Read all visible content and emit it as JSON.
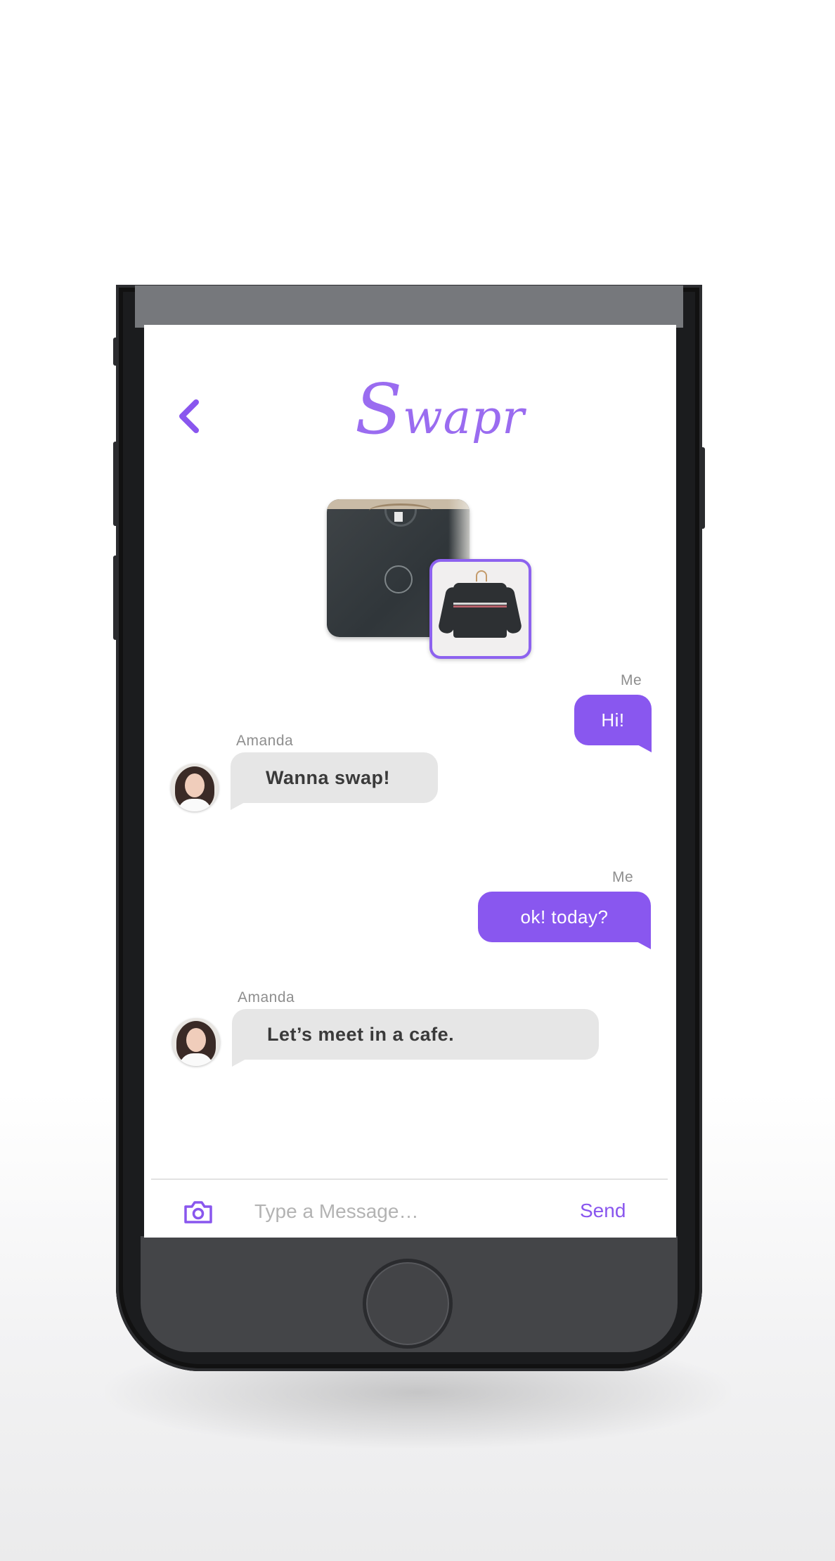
{
  "app": {
    "logo_first": "S",
    "logo_rest": "wapr"
  },
  "colors": {
    "accent": "#8957ef",
    "bubble_them": "#e6e6e6"
  },
  "icons": {
    "back": "chevron-left-icon",
    "camera": "camera-icon"
  },
  "messages": [
    {
      "from": "me",
      "sender": "Me",
      "text": "Hi!"
    },
    {
      "from": "them",
      "sender": "Amanda",
      "text": "Wanna swap!"
    },
    {
      "from": "me",
      "sender": "Me",
      "text": "ok! today?"
    },
    {
      "from": "them",
      "sender": "Amanda",
      "text": "Let’s meet in a cafe."
    }
  ],
  "composer": {
    "placeholder": "Type a Message…",
    "send_label": "Send"
  }
}
